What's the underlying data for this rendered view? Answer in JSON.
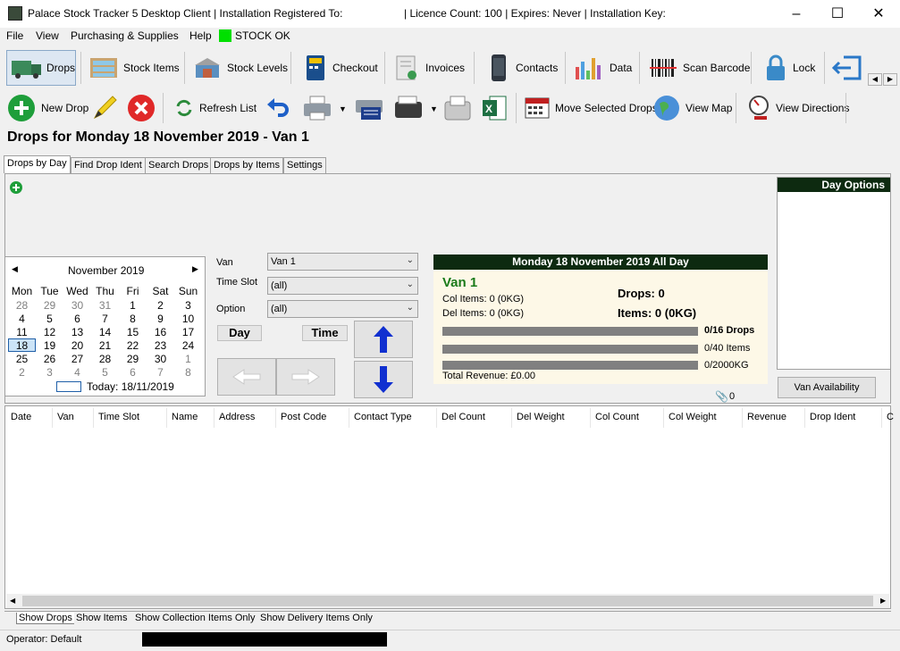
{
  "window": {
    "title_left": "Palace Stock Tracker 5 Desktop Client | Installation Registered To:",
    "title_right": "| Licence Count: 100 | Expires: Never | Installation Key:"
  },
  "menu": {
    "file": "File",
    "view": "View",
    "purchasing": "Purchasing & Supplies",
    "help": "Help",
    "stock_status": "STOCK OK"
  },
  "toolbar": {
    "drops": "Drops",
    "stock_items": "Stock Items",
    "stock_levels": "Stock Levels",
    "checkout": "Checkout",
    "invoices": "Invoices",
    "contacts": "Contacts",
    "data": "Data",
    "scan_barcode": "Scan Barcode",
    "lock": "Lock"
  },
  "toolbar2": {
    "new_drop": "New Drop",
    "refresh_list": "Refresh List",
    "move_selected": "Move Selected Drops",
    "view_map": "View Map",
    "view_directions": "View Directions"
  },
  "page_title": "Drops for Monday 18 November 2019 - Van 1",
  "tabs": [
    "Drops by Day",
    "Find Drop Ident",
    "Search Drops",
    "Drops by Items",
    "Settings"
  ],
  "calendar": {
    "month": "November 2019",
    "weekdays": [
      "Mon",
      "Tue",
      "Wed",
      "Thu",
      "Fri",
      "Sat",
      "Sun"
    ],
    "weeks": [
      [
        "28",
        "29",
        "30",
        "31",
        "1",
        "2",
        "3"
      ],
      [
        "4",
        "5",
        "6",
        "7",
        "8",
        "9",
        "10"
      ],
      [
        "11",
        "12",
        "13",
        "14",
        "15",
        "16",
        "17"
      ],
      [
        "18",
        "19",
        "20",
        "21",
        "22",
        "23",
        "24"
      ],
      [
        "25",
        "26",
        "27",
        "28",
        "29",
        "30",
        "1"
      ],
      [
        "2",
        "3",
        "4",
        "5",
        "6",
        "7",
        "8"
      ]
    ],
    "today_label": "Today: 18/11/2019"
  },
  "form": {
    "van_label": "Van",
    "van_value": "Van 1",
    "timeslot_label": "Time Slot",
    "timeslot_value": "(all)",
    "option_label": "Option",
    "option_value": "(all)",
    "day_button": "Day",
    "time_button": "Time"
  },
  "summary": {
    "heading": "Monday 18 November 2019 All Day",
    "van": "Van 1",
    "col_items": "Col Items: 0 (0KG)",
    "del_items": "Del Items: 0 (0KG)",
    "drops": "Drops: 0",
    "items": "Items: 0 (0KG)",
    "drops_cap": "0/16 Drops",
    "items_cap": "0/40 Items",
    "kg_cap": "0/2000KG",
    "revenue": "Total Revenue: £0.00",
    "attachments": "0"
  },
  "day_options": {
    "title": "Day Options",
    "van_availability": "Van Availability"
  },
  "grid": {
    "columns": [
      "Date",
      "Van",
      "Time Slot",
      "Name",
      "Address",
      "Post Code",
      "Contact Type",
      "Del Count",
      "Del Weight",
      "Col Count",
      "Col Weight",
      "Revenue",
      "Drop Ident",
      "C"
    ]
  },
  "bottom_tabs": [
    "Show Drops",
    "Show Items",
    "Show Collection Items Only",
    "Show Delivery Items Only"
  ],
  "status": {
    "operator": "Operator: Default"
  },
  "colors": {
    "header_green": "#0d2a10",
    "van_green": "#1a7a1a",
    "stock_ok": "#00e000"
  }
}
